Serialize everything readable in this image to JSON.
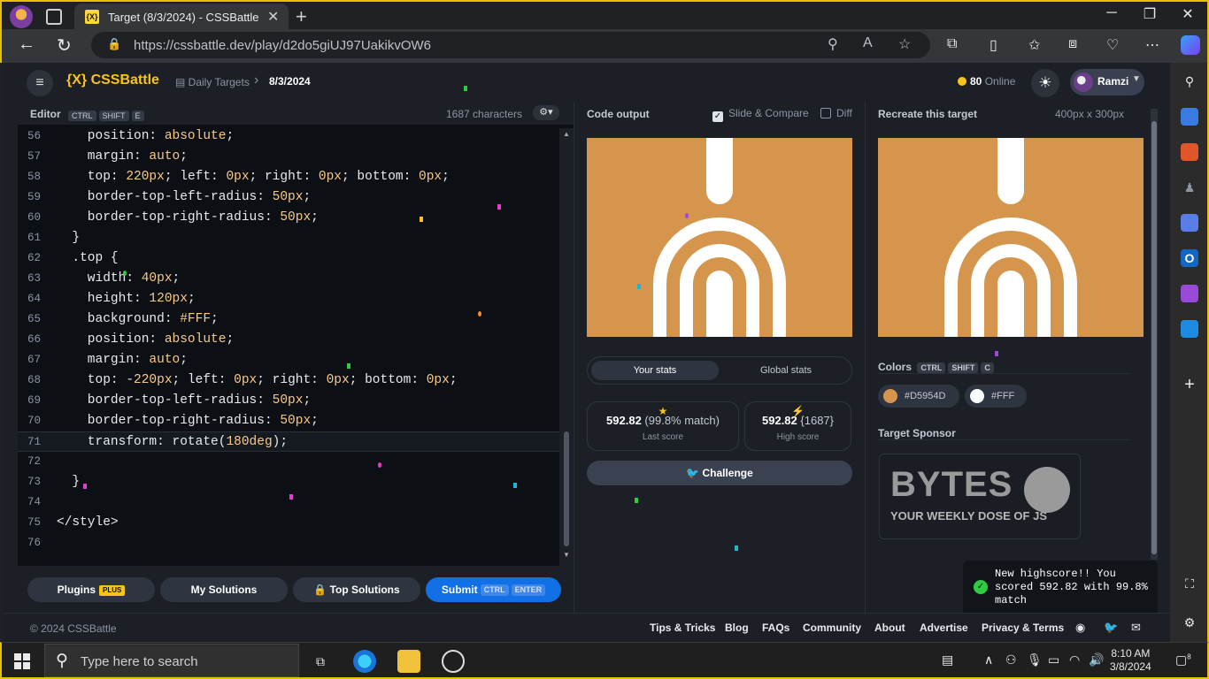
{
  "browser": {
    "tab_title": "Target (8/3/2024) - CSSBattle",
    "tab_favicon": "{X}",
    "url": "https://cssbattle.dev/play/d2do5giUJ97UakikvOW6"
  },
  "header": {
    "logo": "{X} CSSBattle",
    "breadcrumb": [
      "Daily Targets",
      "8/3/2024"
    ],
    "online_count": "80",
    "online_label": "Online",
    "user": "Ramzi"
  },
  "editor": {
    "title": "Editor",
    "shortcut": [
      "CTRL",
      "SHIFT",
      "E"
    ],
    "char_count": "1687 characters",
    "lines": [
      {
        "n": "56",
        "text": "    position: absolute;"
      },
      {
        "n": "57",
        "text": "    margin: auto;"
      },
      {
        "n": "58",
        "text": "    top: 220px; left: 0px; right: 0px; bottom: 0px;"
      },
      {
        "n": "59",
        "text": "    border-top-left-radius: 50px;"
      },
      {
        "n": "60",
        "text": "    border-top-right-radius: 50px;"
      },
      {
        "n": "61",
        "text": "  }"
      },
      {
        "n": "62",
        "text": "  .top {"
      },
      {
        "n": "63",
        "text": "    width: 40px;"
      },
      {
        "n": "64",
        "text": "    height: 120px;"
      },
      {
        "n": "65",
        "text": "    background: #FFF;"
      },
      {
        "n": "66",
        "text": "    position: absolute;"
      },
      {
        "n": "67",
        "text": "    margin: auto;"
      },
      {
        "n": "68",
        "text": "    top: -220px; left: 0px; right: 0px; bottom: 0px;"
      },
      {
        "n": "69",
        "text": "    border-top-left-radius: 50px;"
      },
      {
        "n": "70",
        "text": "    border-top-right-radius: 50px;"
      },
      {
        "n": "71",
        "text": "    transform: rotate(180deg);"
      },
      {
        "n": "72",
        "text": ""
      },
      {
        "n": "73",
        "text": "  }"
      },
      {
        "n": "74",
        "text": ""
      },
      {
        "n": "75",
        "text": "</style>"
      },
      {
        "n": "76",
        "text": ""
      }
    ],
    "buttons": {
      "plugins": "Plugins",
      "plugins_badge": "PLUS",
      "my_solutions": "My Solutions",
      "top_solutions": "Top Solutions",
      "submit": "Submit",
      "submit_keys": [
        "CTRL",
        "ENTER"
      ]
    }
  },
  "output": {
    "title": "Code output",
    "slide_compare": "Slide & Compare",
    "slide_compare_checked": true,
    "diff": "Diff",
    "diff_checked": false,
    "stats_tabs": [
      "Your stats",
      "Global stats"
    ],
    "last_score": "592.82",
    "last_match": "(99.8% match)",
    "last_label": "Last score",
    "high_score": "592.82",
    "high_chars": "{1687}",
    "high_label": "High score",
    "challenge": "Challenge"
  },
  "target": {
    "title": "Recreate this target",
    "size": "400px x 300px",
    "colors_title": "Colors",
    "colors_keys": [
      "CTRL",
      "SHIFT",
      "C"
    ],
    "colors": [
      {
        "hex": "#D5954D",
        "swatch": "#D5954D"
      },
      {
        "hex": "#FFF",
        "swatch": "#FFFFFF"
      }
    ],
    "sponsor_title": "Target Sponsor",
    "sponsor_word": "BYTES",
    "sponsor_tag": "YOUR WEEKLY DOSE OF JS"
  },
  "toast": {
    "text": "New highscore!! You scored 592.82 with 99.8% match"
  },
  "footer": {
    "copyright": "© 2024 CSSBattle",
    "links": [
      "Tips & Tricks",
      "Blog",
      "FAQs",
      "Community",
      "About",
      "Advertise",
      "Privacy & Terms"
    ]
  },
  "taskbar": {
    "search_placeholder": "Type here to search",
    "time": "8:10 AM",
    "date": "3/8/2024",
    "notifications": "8"
  },
  "colors": {
    "accent": "#F9C31A",
    "target_bg": "#D5954D",
    "submit": "#1170E6"
  }
}
